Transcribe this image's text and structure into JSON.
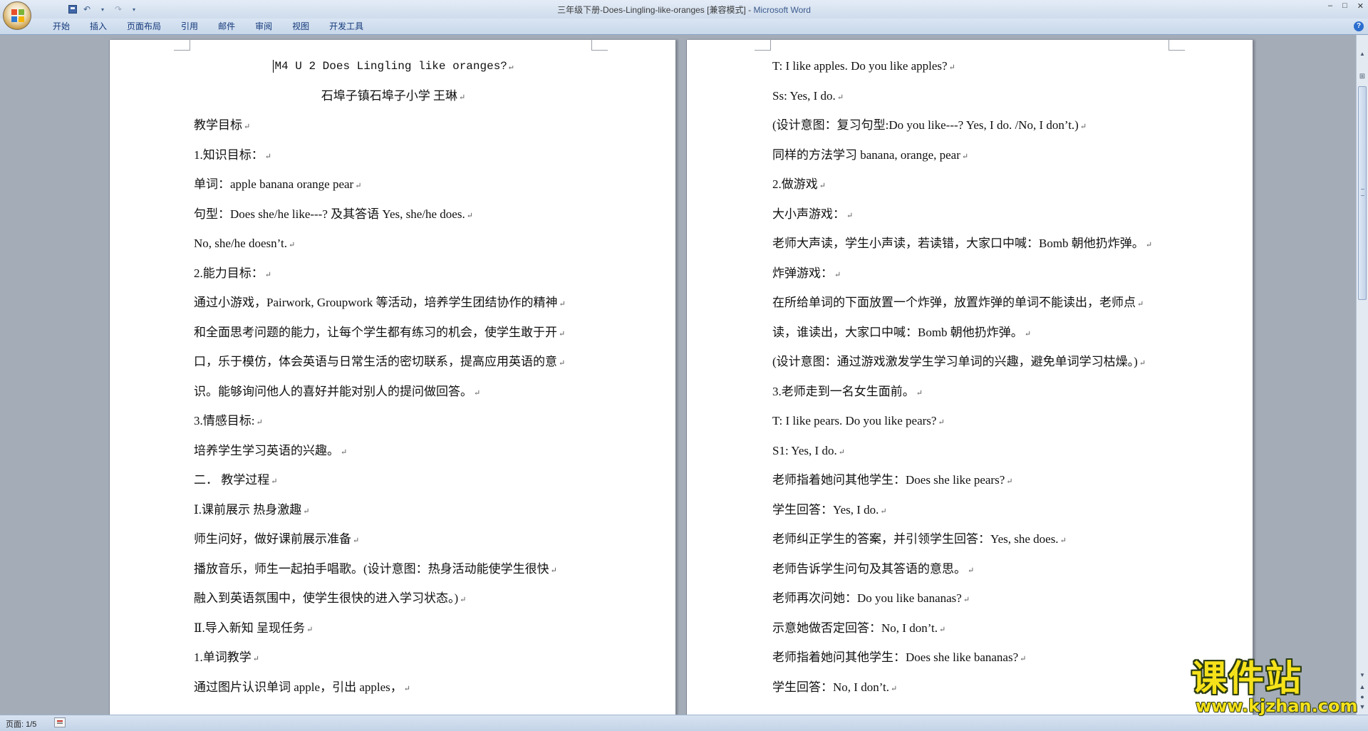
{
  "window": {
    "title": "三年级下册-Does-Lingling-like-oranges [兼容模式] - ",
    "app_name": "Microsoft Word",
    "controls": [
      "–",
      "□",
      "✕"
    ]
  },
  "ribbon": {
    "tabs": [
      "开始",
      "插入",
      "页面布局",
      "引用",
      "邮件",
      "审阅",
      "视图",
      "开发工具"
    ],
    "help": "?"
  },
  "pages": {
    "left": {
      "lines": [
        {
          "text": "M4 U 2  Does Lingling like oranges?",
          "style": "center mono",
          "caret": true
        },
        {
          "text": "石埠子镇石埠子小学  王琳",
          "style": "center"
        },
        {
          "text": "教学目标"
        },
        {
          "text": "1.知识目标："
        },
        {
          "text": "单词：apple    banana    orange    pear"
        },
        {
          "text": "句型：Does she/he like---?  及其答语  Yes, she/he does."
        },
        {
          "text": "No, she/he doesn’t."
        },
        {
          "text": "2.能力目标："
        },
        {
          "text": "通过小游戏，Pairwork, Groupwork 等活动，培养学生团结协作的精神"
        },
        {
          "text": "和全面思考问题的能力，让每个学生都有练习的机会，使学生敢于开"
        },
        {
          "text": "口，乐于模仿，体会英语与日常生活的密切联系，提高应用英语的意"
        },
        {
          "text": "识。能够询问他人的喜好并能对别人的提问做回答。"
        },
        {
          "text": "3.情感目标:"
        },
        {
          "text": "培养学生学习英语的兴趣。"
        },
        {
          "text": "二．  教学过程"
        },
        {
          "text": "Ⅰ.课前展示    热身激趣"
        },
        {
          "text": "师生问好，做好课前展示准备"
        },
        {
          "text": "播放音乐，师生一起拍手唱歌。(设计意图：热身活动能使学生很快"
        },
        {
          "text": "融入到英语氛围中，使学生很快的进入学习状态。)"
        },
        {
          "text": "Ⅱ.导入新知    呈现任务"
        },
        {
          "text": "1.单词教学"
        },
        {
          "text": "通过图片认识单词 apple，引出 apples，"
        }
      ]
    },
    "right": {
      "lines": [
        {
          "text": "T: I like apples. Do you like apples?"
        },
        {
          "text": "Ss: Yes, I do."
        },
        {
          "text": "(设计意图：复习句型:Do you like---? Yes, I do. /No, I don’t.)"
        },
        {
          "text": "同样的方法学习 banana, orange, pear"
        },
        {
          "text": "2.做游戏"
        },
        {
          "text": "大小声游戏："
        },
        {
          "text": "老师大声读，学生小声读，若读错，大家口中喊：Bomb 朝他扔炸弹。"
        },
        {
          "text": "炸弹游戏："
        },
        {
          "text": "在所给单词的下面放置一个炸弹，放置炸弹的单词不能读出，老师点"
        },
        {
          "text": "读，谁读出，大家口中喊：Bomb 朝他扔炸弹。"
        },
        {
          "text": "(设计意图：通过游戏激发学生学习单词的兴趣，避免单词学习枯燥。)"
        },
        {
          "text": "3.老师走到一名女生面前。"
        },
        {
          "text": "T: I like pears. Do you like pears?"
        },
        {
          "text": "S1: Yes, I do."
        },
        {
          "text": "老师指着她问其他学生：Does she like pears?"
        },
        {
          "text": "学生回答：Yes, I do."
        },
        {
          "text": "老师纠正学生的答案，并引领学生回答：Yes, she does."
        },
        {
          "text": "老师告诉学生问句及其答语的意思。"
        },
        {
          "text": "老师再次问她：Do you like bananas?"
        },
        {
          "text": "示意她做否定回答：No, I don’t."
        },
        {
          "text": "老师指着她问其他学生：Does she like bananas?"
        },
        {
          "text": "学生回答：No, I don’t."
        }
      ]
    },
    "paragraph_mark": "↵"
  },
  "statusbar": {
    "page_info": "页面: 1/5"
  },
  "watermark": {
    "title": "课件站",
    "url": "www.kjzhan.com"
  },
  "colors": {
    "app_name": "#3b5a8c",
    "tab_text": "#15397b",
    "workspace": "#a4acb8",
    "watermark": "#f6e21a"
  }
}
